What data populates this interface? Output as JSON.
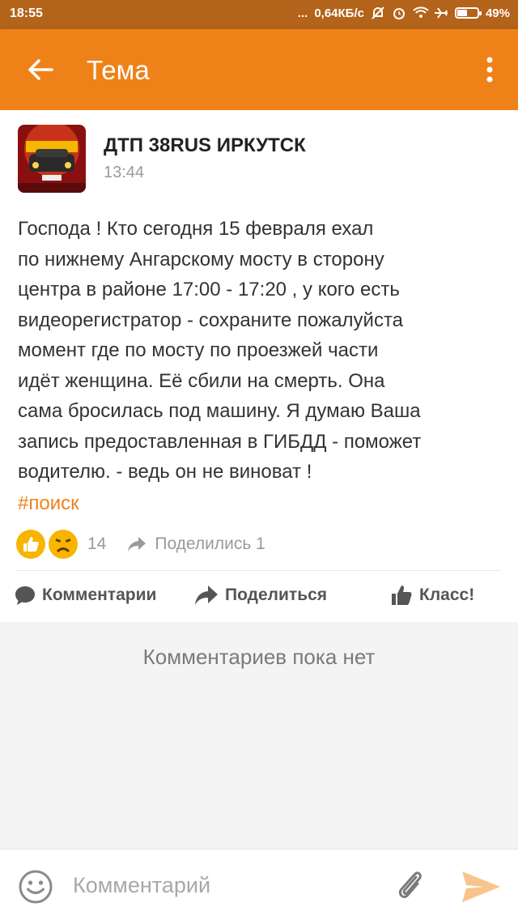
{
  "status_bar": {
    "time": "18:55",
    "dots": "...",
    "speed": "0,64КБ/с",
    "battery_percent": "49%",
    "battery_level": 0.49
  },
  "header": {
    "title": "Тема"
  },
  "post": {
    "author": "ДТП 38RUS ИРКУТСК",
    "time": "13:44",
    "text_lines": [
      "Господа ! Кто сегодня 15 февраля ехал",
      "по нижнему Ангарскому мосту в сторону",
      "центра в районе 17:00 - 17:20 , у кого есть",
      "видеорегистратор - сохраните пожалуйста",
      "момент где по мосту по проезжей части",
      "идёт женщина. Её сбили на смерть. Она",
      "сама бросилась под машину. Я думаю Ваша",
      "запись предоставленная в ГИБДД - поможет",
      "водителю. - ведь он не виноват !"
    ],
    "hashtag": "#поиск",
    "reactions_count": "14",
    "shares_text": "Поделились 1"
  },
  "actions": {
    "comments": "Комментарии",
    "share": "Поделиться",
    "like": "Класс!"
  },
  "comments": {
    "empty_text": "Комментариев пока нет"
  },
  "comment_input": {
    "placeholder": "Комментарий"
  },
  "colors": {
    "accent": "#ee8219",
    "status_bar": "#b3631a",
    "reaction": "#f7b500"
  }
}
